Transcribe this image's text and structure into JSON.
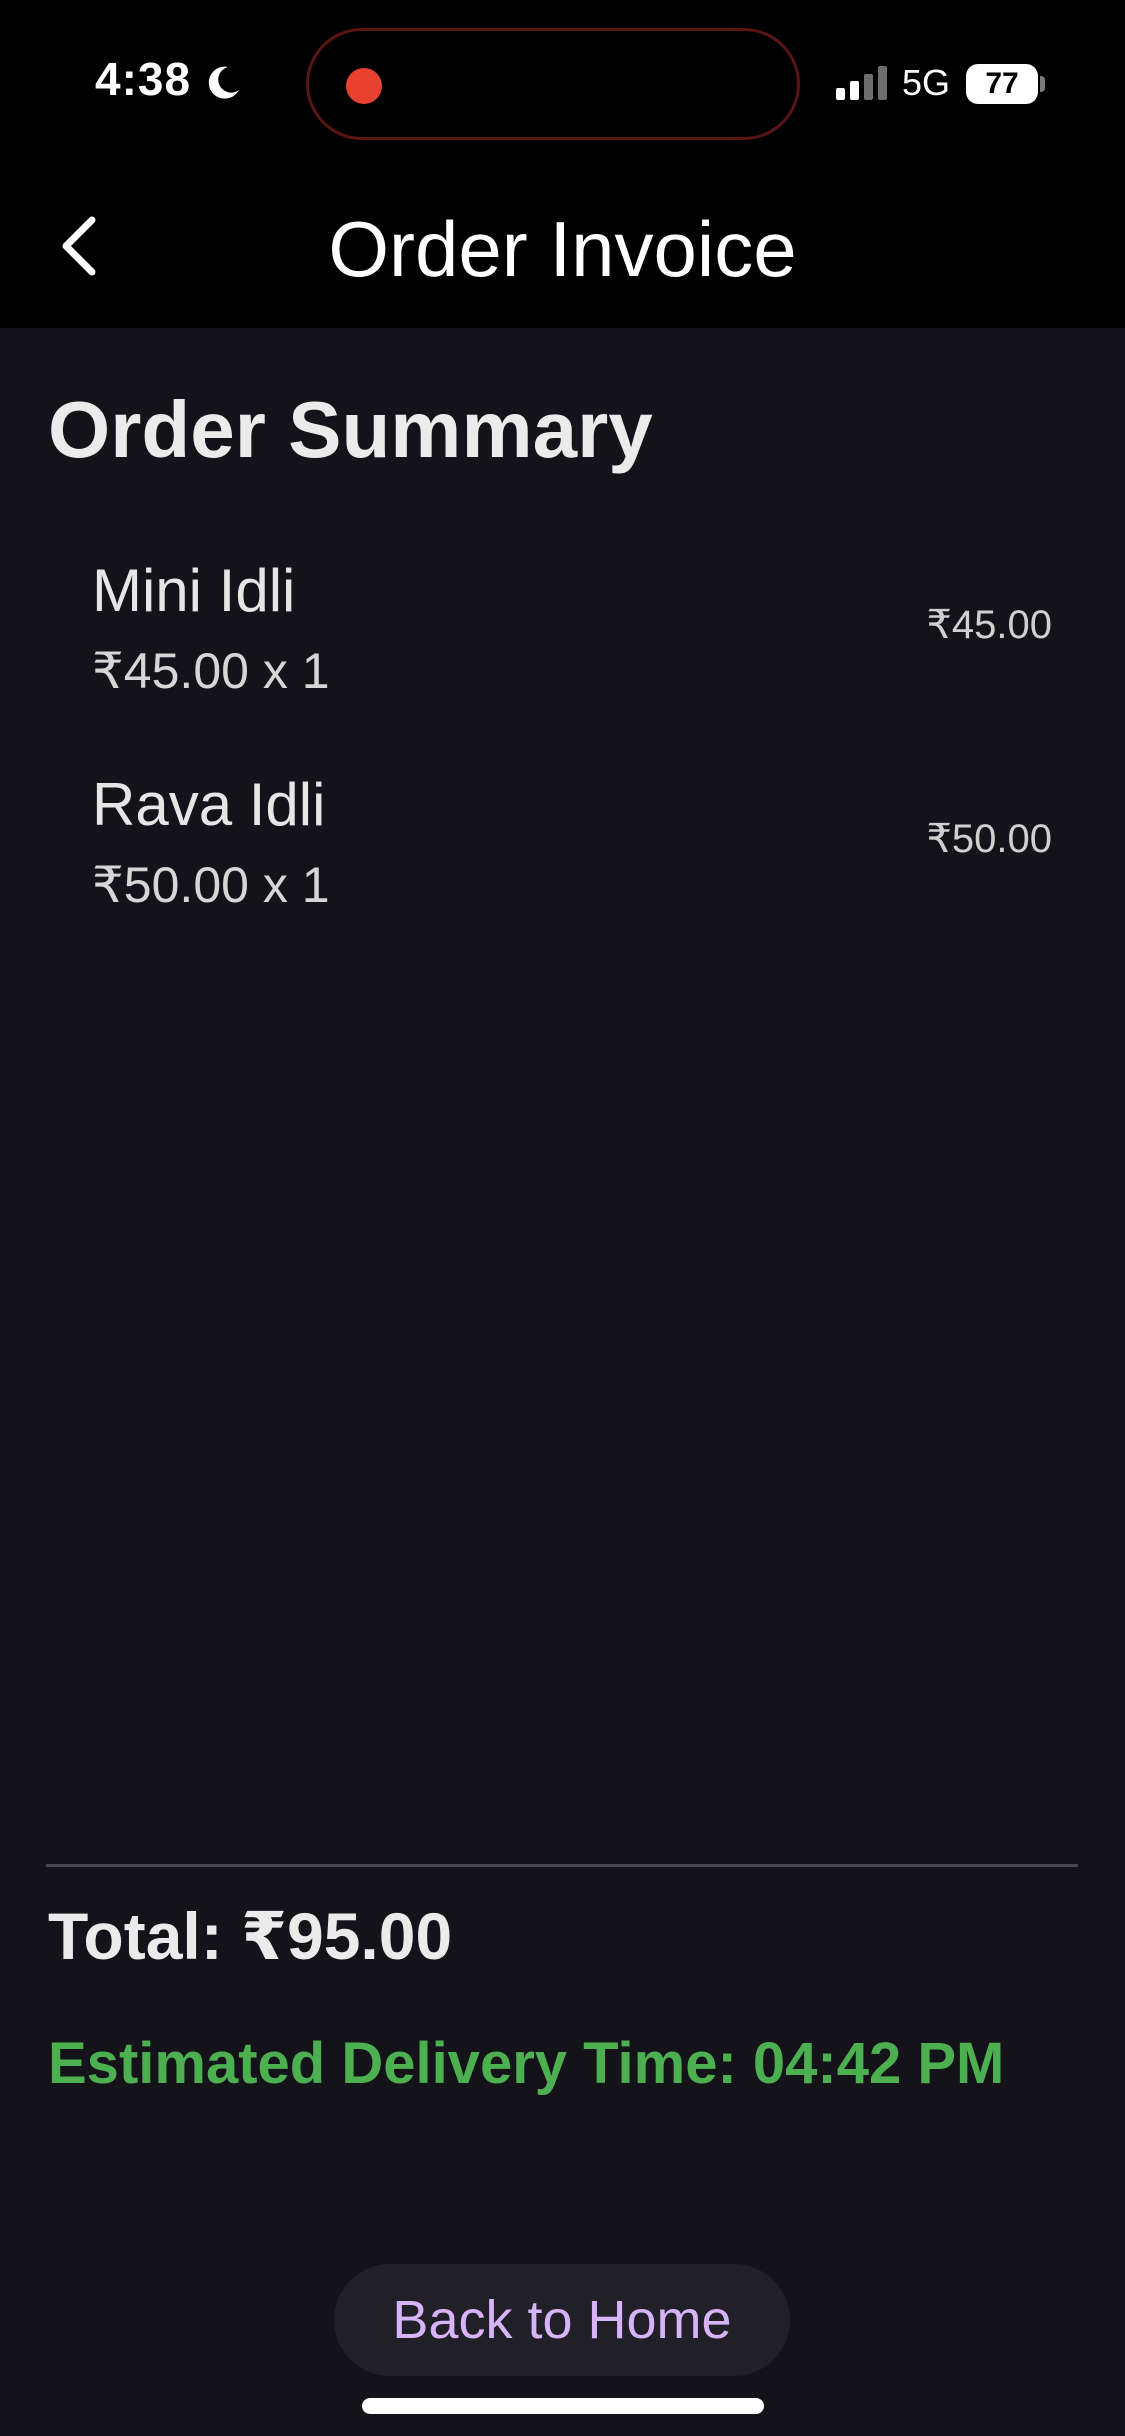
{
  "status_bar": {
    "time": "4:38",
    "moon_icon": "moon-icon",
    "network": "5G",
    "battery": "77"
  },
  "header": {
    "title": "Order Invoice",
    "back_icon": "chevron-left-icon"
  },
  "summary": {
    "title": "Order Summary",
    "items": [
      {
        "name": "Mini Idli",
        "qty_line": "₹45.00 x 1",
        "line_total": "₹45.00"
      },
      {
        "name": "Rava Idli",
        "qty_line": "₹50.00 x 1",
        "line_total": "₹50.00"
      }
    ]
  },
  "footer": {
    "total": "Total: ₹95.00",
    "delivery": "Estimated Delivery Time: 04:42 PM",
    "home_button": "Back to Home"
  },
  "colors": {
    "background": "#15131a",
    "header_background": "#000000",
    "delivery_text": "#4caf50",
    "button_text": "#d6b4f7",
    "button_background": "#211f27",
    "recording_dot": "#e8412f"
  }
}
